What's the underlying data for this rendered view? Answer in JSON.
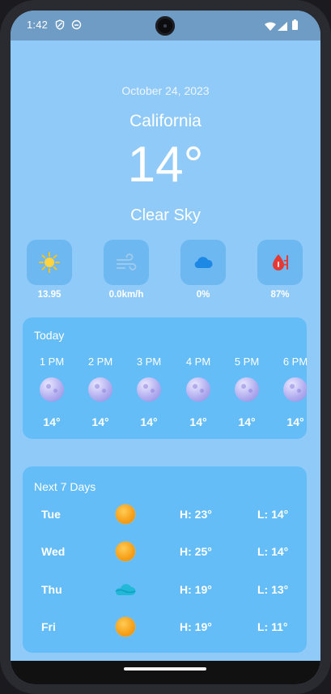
{
  "status": {
    "time": "1:42",
    "icons": [
      "shield-icon",
      "notification-icon",
      "wifi-icon",
      "signal-icon",
      "battery-icon"
    ]
  },
  "weather": {
    "date": "October 24, 2023",
    "city": "California",
    "temperature": "14°",
    "condition": "Clear Sky"
  },
  "stats": [
    {
      "icon": "sun-icon",
      "value": "13.95"
    },
    {
      "icon": "wind-icon",
      "value": "0.0km/h"
    },
    {
      "icon": "cloud-icon",
      "value": "0%"
    },
    {
      "icon": "humidity-icon",
      "value": "87%"
    }
  ],
  "today": {
    "title": "Today",
    "hours": [
      {
        "time": "1 PM",
        "temp": "14°",
        "icon": "moon-icon"
      },
      {
        "time": "2 PM",
        "temp": "14°",
        "icon": "moon-icon"
      },
      {
        "time": "3 PM",
        "temp": "14°",
        "icon": "moon-icon"
      },
      {
        "time": "4 PM",
        "temp": "14°",
        "icon": "moon-icon"
      },
      {
        "time": "5 PM",
        "temp": "14°",
        "icon": "moon-icon"
      },
      {
        "time": "6 PM",
        "temp": "14°",
        "icon": "moon-icon"
      }
    ]
  },
  "week": {
    "title": "Next 7 Days",
    "days": [
      {
        "day": "Tue",
        "icon": "sun-icon",
        "high": "H: 23°",
        "low": "L: 14°"
      },
      {
        "day": "Wed",
        "icon": "sun-icon",
        "high": "H: 25°",
        "low": "L: 14°"
      },
      {
        "day": "Thu",
        "icon": "partly-cloudy-icon",
        "high": "H: 19°",
        "low": "L: 13°"
      },
      {
        "day": "Fri",
        "icon": "sun-icon",
        "high": "H: 19°",
        "low": "L: 11°"
      }
    ]
  },
  "colors": {
    "background": "#90CAF9",
    "card": "#64BDF6",
    "tile": "#6DB8F0",
    "sun": "#F7A21B",
    "moon": "#B3AFF0"
  }
}
